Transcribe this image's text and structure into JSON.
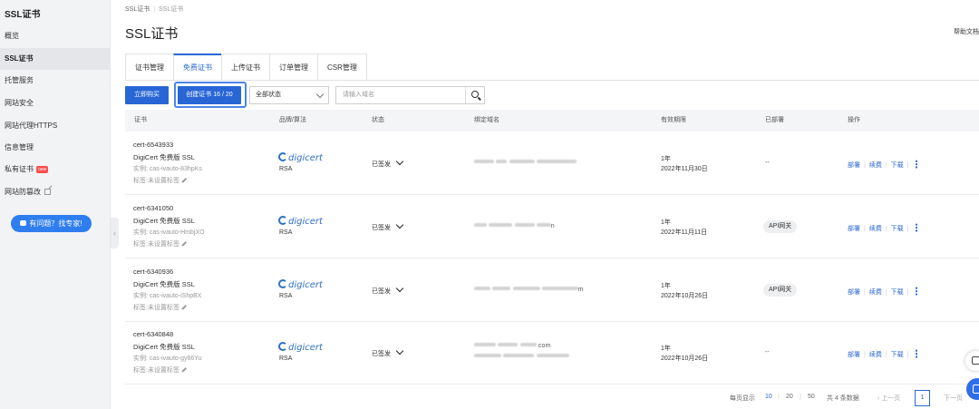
{
  "sidebar": {
    "title": "SSL证书",
    "items": [
      {
        "label": "概览"
      },
      {
        "label": "SSL证书"
      },
      {
        "label": "托管服务"
      },
      {
        "label": "网站安全"
      },
      {
        "label": "网站代理HTTPS"
      },
      {
        "label": "信息管理"
      },
      {
        "label": "私有证书",
        "badge": "new"
      },
      {
        "label": "网站防篡改"
      }
    ],
    "expert_button": "有问题？找专家!",
    "collapse_glyph": "‹"
  },
  "breadcrumb": {
    "root": "SSL证书",
    "current": "SSL证书"
  },
  "page_title": "SSL证书",
  "help_link": "帮助文档",
  "tabs": [
    {
      "label": "证书管理"
    },
    {
      "label": "免费证书",
      "active": true
    },
    {
      "label": "上传证书"
    },
    {
      "label": "订单管理"
    },
    {
      "label": "CSR管理"
    }
  ],
  "toolbar": {
    "buy_label": "立即购买",
    "create_label": "创建证书 16 / 20",
    "status_select": "全部状态",
    "search_placeholder": "请输入域名"
  },
  "table": {
    "headers": [
      "证书",
      "品牌/算法",
      "状态",
      "绑定域名",
      "有效期限",
      "已部署",
      "操作"
    ],
    "tag_label": "标签:未设置标签",
    "rows": [
      {
        "id": "cert-6543933",
        "product": "DigiCert 免费版 SSL",
        "instance": "实例: cas-ivauto-83hpKs",
        "brand": "digicert",
        "algo": "RSA",
        "status": "已签发",
        "domain_lines": [
          ""
        ],
        "period": "1年",
        "expiry": "2022年11月30日",
        "deployed": "--",
        "ops": [
          "部署",
          "续费",
          "下载"
        ]
      },
      {
        "id": "cert-6341050",
        "product": "DigiCert 免费版 SSL",
        "instance": "实例: cas-ivauto-HmbjXO",
        "brand": "digicert",
        "algo": "RSA",
        "status": "已签发",
        "domain_lines": [
          "n"
        ],
        "period": "1年",
        "expiry": "2022年11月11日",
        "deployed": "API网关",
        "ops": [
          "部署",
          "续费",
          "下载"
        ]
      },
      {
        "id": "cert-6340936",
        "product": "DigiCert 免费版 SSL",
        "instance": "实例: cas-ivauto-iShpBX",
        "brand": "digicert",
        "algo": "RSA",
        "status": "已签发",
        "domain_lines": [
          "m"
        ],
        "period": "1年",
        "expiry": "2022年10月26日",
        "deployed": "API网关",
        "ops": [
          "部署",
          "续费",
          "下载"
        ]
      },
      {
        "id": "cert-6340848",
        "product": "DigiCert 免费版 SSL",
        "instance": "实例: cas-ivauto-gy86Yu",
        "brand": "digicert",
        "algo": "RSA",
        "status": "已签发",
        "domain_lines": [
          "com",
          ""
        ],
        "period": "1年",
        "expiry": "2022年10月26日",
        "deployed": "--",
        "ops": [
          "部署",
          "续费",
          "下载"
        ]
      }
    ]
  },
  "pager": {
    "per_page_label": "每页显示",
    "sizes": [
      "10",
      "20",
      "50"
    ],
    "total": "共 4 条数据",
    "prev": "‹ 上一页",
    "page": "1",
    "next": "下一页"
  },
  "colors": {
    "accent": "#2866d6",
    "sidebar_bg": "#f2f3f5",
    "badge_new": "#ff4d4f",
    "expert_btn": "#2f7ef0"
  }
}
